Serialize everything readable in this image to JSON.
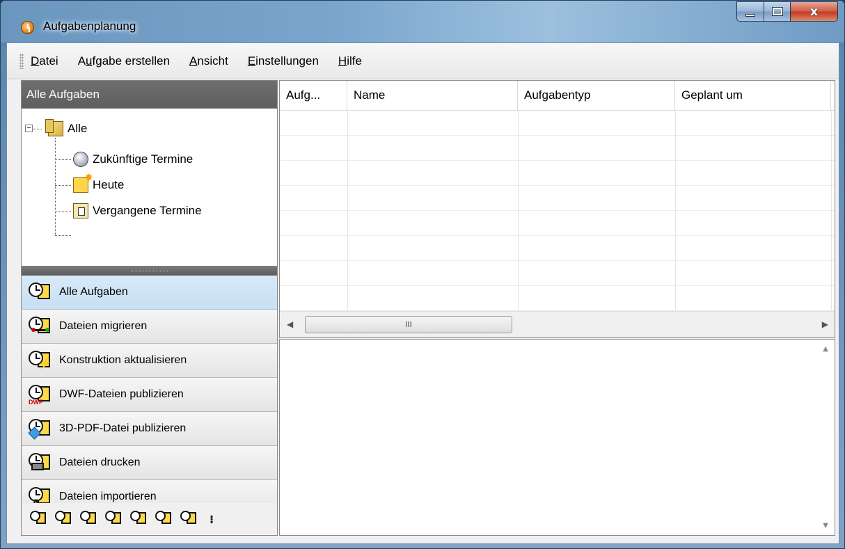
{
  "window": {
    "title": "Aufgabenplanung",
    "controls": {
      "minimize": "minimize",
      "maximize": "maximize",
      "close": "x"
    }
  },
  "menu": [
    {
      "label": "Datei",
      "mnemonic": "D"
    },
    {
      "label": "Aufgabe erstellen",
      "mnemonic": "u"
    },
    {
      "label": "Ansicht",
      "mnemonic": "A"
    },
    {
      "label": "Einstellungen",
      "mnemonic": "E"
    },
    {
      "label": "Hilfe",
      "mnemonic": "H"
    }
  ],
  "left_pane": {
    "header": "Alle Aufgaben",
    "tree": {
      "root": {
        "label": "Alle",
        "icon": "folders-icon",
        "expander": "−"
      },
      "children": [
        {
          "label": "Zukünftige Termine",
          "icon": "globe-icon"
        },
        {
          "label": "Heute",
          "icon": "today-icon"
        },
        {
          "label": "Vergangene Termine",
          "icon": "past-icon"
        }
      ]
    },
    "nav": [
      {
        "label": "Alle Aufgaben",
        "icon": "clock-task-icon",
        "active": true
      },
      {
        "label": "Dateien migrieren",
        "icon": "migrate-icon"
      },
      {
        "label": "Konstruktion aktualisieren",
        "icon": "update-design-icon"
      },
      {
        "label": "DWF-Dateien publizieren",
        "icon": "dwf-icon",
        "badge": "DWF"
      },
      {
        "label": "3D-PDF-Datei publizieren",
        "icon": "3d-pdf-icon"
      },
      {
        "label": "Dateien drucken",
        "icon": "print-icon"
      },
      {
        "label": "Dateien importieren",
        "icon": "import-icon"
      }
    ]
  },
  "table": {
    "columns": [
      "Aufg...",
      "Name",
      "Aufgabentyp",
      "Geplant um"
    ],
    "rows": []
  },
  "scroll": {
    "grip": "III"
  }
}
